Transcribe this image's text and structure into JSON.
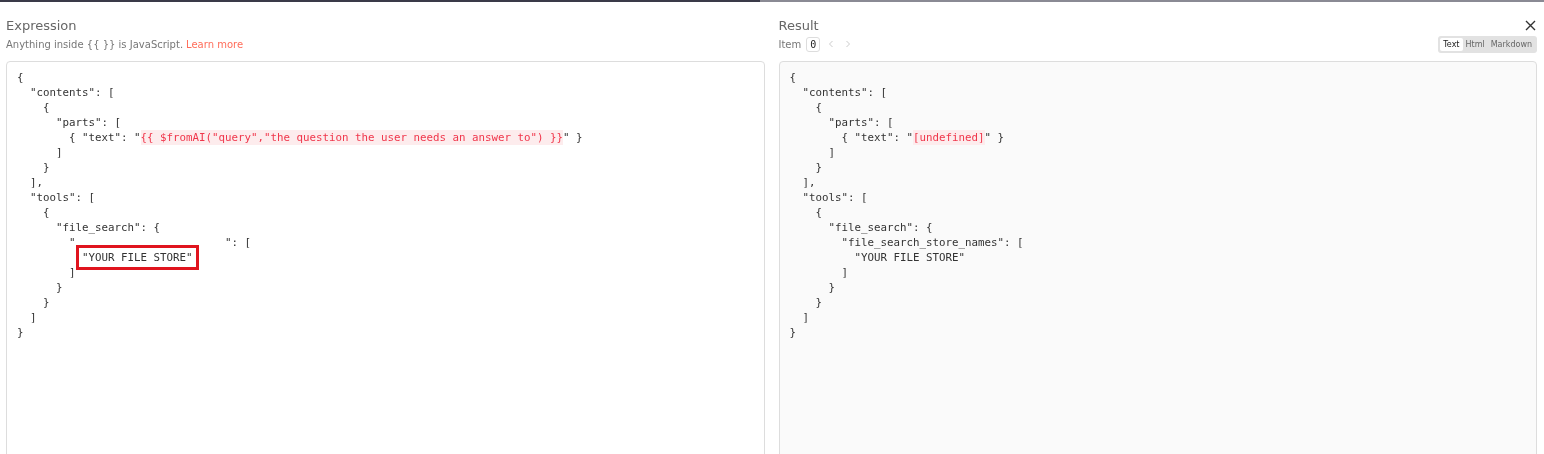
{
  "expression": {
    "title": "Expression",
    "hint": "Anything inside {{  }} is JavaScript.",
    "hint_link": "Learn more",
    "lines": [
      [
        {
          "text": "{",
          "kind": "plain"
        }
      ],
      [
        {
          "text": "  \"contents\": [",
          "kind": "plain"
        }
      ],
      [
        {
          "text": "    {",
          "kind": "plain"
        }
      ],
      [
        {
          "text": "      \"parts\": [",
          "kind": "plain"
        }
      ],
      [
        {
          "text": "        { \"text\": \"",
          "kind": "plain"
        },
        {
          "text": "{{ $fromAI(\"query\",\"the question the user needs an answer to\") }}",
          "kind": "highlight"
        },
        {
          "text": "\" }",
          "kind": "plain"
        }
      ],
      [
        {
          "text": "      ]",
          "kind": "plain"
        }
      ],
      [
        {
          "text": "    }",
          "kind": "plain"
        }
      ],
      [
        {
          "text": "  ],",
          "kind": "plain"
        }
      ],
      [
        {
          "text": "  \"tools\": [",
          "kind": "plain"
        }
      ],
      [
        {
          "text": "    {",
          "kind": "plain"
        }
      ],
      [
        {
          "text": "      \"file_search\": {",
          "kind": "plain"
        }
      ],
      [
        {
          "text": "        \"",
          "kind": "plain"
        },
        {
          "text": "\": [",
          "kind": "after_cover"
        }
      ],
      [
        {
          "text": "          \"YOUR FILE STORE\"",
          "kind": "marked"
        }
      ],
      [
        {
          "text": "        ]",
          "kind": "plain"
        }
      ],
      [
        {
          "text": "      }",
          "kind": "plain"
        }
      ],
      [
        {
          "text": "    }",
          "kind": "plain"
        }
      ],
      [
        {
          "text": "  ]",
          "kind": "plain"
        }
      ],
      [
        {
          "text": "}",
          "kind": "plain"
        }
      ]
    ]
  },
  "result": {
    "title": "Result",
    "item_label": "Item",
    "item_value": "0",
    "formats": [
      {
        "label": "Text",
        "selected": true
      },
      {
        "label": "Html",
        "selected": false
      },
      {
        "label": "Markdown",
        "selected": false
      }
    ],
    "lines": [
      [
        {
          "text": "{",
          "kind": "plain"
        }
      ],
      [
        {
          "text": "  \"contents\": [",
          "kind": "plain"
        }
      ],
      [
        {
          "text": "    {",
          "kind": "plain"
        }
      ],
      [
        {
          "text": "      \"parts\": [",
          "kind": "plain"
        }
      ],
      [
        {
          "text": "        { \"text\": \"",
          "kind": "plain"
        },
        {
          "text": "[undefined]",
          "kind": "highlight"
        },
        {
          "text": "\" }",
          "kind": "plain"
        }
      ],
      [
        {
          "text": "      ]",
          "kind": "plain"
        }
      ],
      [
        {
          "text": "    }",
          "kind": "plain"
        }
      ],
      [
        {
          "text": "  ],",
          "kind": "plain"
        }
      ],
      [
        {
          "text": "  \"tools\": [",
          "kind": "plain"
        }
      ],
      [
        {
          "text": "    {",
          "kind": "plain"
        }
      ],
      [
        {
          "text": "      \"file_search\": {",
          "kind": "plain"
        }
      ],
      [
        {
          "text": "        \"file_search_store_names\": [",
          "kind": "plain"
        }
      ],
      [
        {
          "text": "          \"YOUR FILE STORE\"",
          "kind": "plain"
        }
      ],
      [
        {
          "text": "        ]",
          "kind": "plain"
        }
      ],
      [
        {
          "text": "      }",
          "kind": "plain"
        }
      ],
      [
        {
          "text": "    }",
          "kind": "plain"
        }
      ],
      [
        {
          "text": "  ]",
          "kind": "plain"
        }
      ],
      [
        {
          "text": "}",
          "kind": "plain"
        }
      ]
    ]
  }
}
